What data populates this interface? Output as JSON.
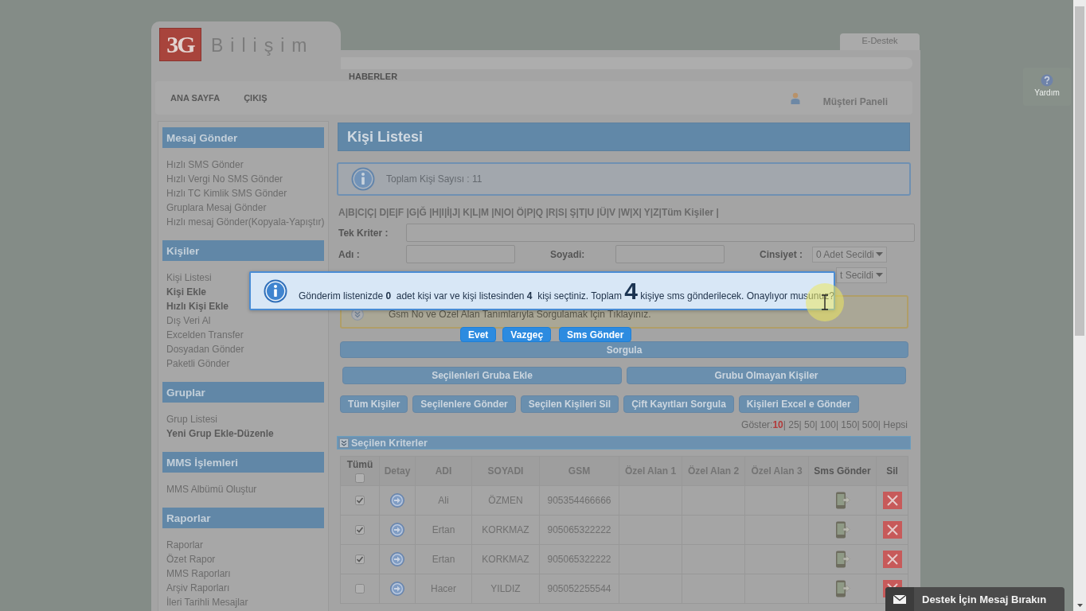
{
  "header": {
    "logo_mark": "3G",
    "logo_text": "Bilişim",
    "top_tab": "E-Destek",
    "news_label": "HABERLER"
  },
  "nav": {
    "links": [
      "ANA SAYFA",
      "ÇIKIŞ"
    ],
    "panel_link": "Müşteri Paneli"
  },
  "help_button": {
    "label": "Yardım"
  },
  "sidebar": [
    {
      "title": "Mesaj Gönder",
      "items": [
        {
          "label": "Hızlı SMS Gönder",
          "emphasized": false
        },
        {
          "label": "Hızlı Vergi No SMS Gönder",
          "emphasized": false
        },
        {
          "label": "Hızlı TC Kimlik SMS Gönder",
          "emphasized": false
        },
        {
          "label": "Gruplara Mesaj Gönder",
          "emphasized": false
        },
        {
          "label": "Hızlı mesaj Gönder(Kopyala-Yapıştır)",
          "emphasized": false
        }
      ]
    },
    {
      "title": "Kişiler",
      "items": [
        {
          "label": "Kişi Listesi",
          "emphasized": false
        },
        {
          "label": "Kişi Ekle",
          "emphasized": true
        },
        {
          "label": "Hızlı Kişi Ekle",
          "emphasized": true
        },
        {
          "label": "Dış Veri Al",
          "emphasized": false
        },
        {
          "label": "Excelden Transfer",
          "emphasized": false
        },
        {
          "label": "Dosyadan Gönder",
          "emphasized": false
        },
        {
          "label": "Paketli Gönder",
          "emphasized": false
        }
      ]
    },
    {
      "title": "Gruplar",
      "items": [
        {
          "label": "Grup Listesi",
          "emphasized": false
        },
        {
          "label": "Yeni Grup Ekle-Düzenle",
          "emphasized": true
        }
      ]
    },
    {
      "title": "MMS İşlemleri",
      "items": [
        {
          "label": "MMS Albümü Oluştur",
          "emphasized": false
        }
      ]
    },
    {
      "title": "Raporlar",
      "items": [
        {
          "label": "Raporlar",
          "emphasized": false
        },
        {
          "label": "Özet Rapor",
          "emphasized": false
        },
        {
          "label": "MMS Raporları",
          "emphasized": false
        },
        {
          "label": "Arşiv Raporları",
          "emphasized": false
        },
        {
          "label": "İleri Tarihli Mesajlar",
          "emphasized": false
        }
      ]
    }
  ],
  "content": {
    "title": "Kişi Listesi",
    "info": "Toplam Kişi Sayısı : 11",
    "alphabet_filter": "A|B|C|Ç| D|E|F |G|Ğ |H|I|İ|J| K|L|M |N|O| Ö|P|Q |R|S| Ş|T|U |Ü|V |W|X| Y|Z|Tüm Kişiler |",
    "search_form": {
      "single_criterion_label": "Tek Kriter :",
      "first_name_label": "Adı :",
      "last_name_label": "Soyadi:",
      "gender_label": "Cinsiyet :",
      "gender_value": "0 Adet Secildi",
      "select_2_value": "t Secildi"
    },
    "criteria_hint": "Gsm No ve Özel Alan Tanımlarıyla Sorgulamak İçin Tıklayınız.",
    "query_button": "Sorgula",
    "group_buttons": [
      "Seçilenleri Gruba Ekle",
      "Grubu Olmayan Kişiler"
    ],
    "action_buttons": [
      "Tüm Kişiler",
      "Seçilenlere Gönder",
      "Seçilen Kişileri Sil",
      "Çift Kayıtları Sorgula",
      "Kişileri Excel e Gönder"
    ],
    "page_size": {
      "label": "Göster:",
      "options": [
        {
          "label": "10",
          "selected": true
        },
        {
          "label": "| 25",
          "selected": false
        },
        {
          "label": "| 50",
          "selected": false
        },
        {
          "label": "| 100",
          "selected": false
        },
        {
          "label": "| 150",
          "selected": false
        },
        {
          "label": "| 500",
          "selected": false
        },
        {
          "label": "| Hepsi",
          "selected": false
        }
      ]
    },
    "criteria_bar": "Seçilen Kriterler",
    "table": {
      "select_all": false,
      "columns": [
        {
          "label": "Tümü",
          "kind": "select",
          "sortable": false
        },
        {
          "label": "Detay",
          "kind": "detail",
          "sortable": true
        },
        {
          "label": "ADI",
          "kind": "first_name",
          "sortable": true
        },
        {
          "label": "SOYADI",
          "kind": "last_name",
          "sortable": true
        },
        {
          "label": "GSM",
          "kind": "gsm",
          "sortable": true
        },
        {
          "label": "Özel Alan 1",
          "kind": "custom",
          "sortable": true
        },
        {
          "label": "Özel Alan 2",
          "kind": "custom",
          "sortable": true
        },
        {
          "label": "Özel Alan 3",
          "kind": "custom",
          "sortable": true
        },
        {
          "label": "Sms Gönder",
          "kind": "sms",
          "sortable": false
        },
        {
          "label": "Sil",
          "kind": "delete",
          "sortable": false
        }
      ],
      "rows": [
        {
          "checked": true,
          "first_name": "Ali",
          "last_name": "ÖZMEN",
          "gsm": "905354466666"
        },
        {
          "checked": true,
          "first_name": "Ertan",
          "last_name": "KORKMAZ",
          "gsm": "905065322222"
        },
        {
          "checked": true,
          "first_name": "Ertan",
          "last_name": "KORKMAZ",
          "gsm": "905065322222"
        },
        {
          "checked": false,
          "first_name": "Hacer",
          "last_name": "YILDIZ",
          "gsm": "905052255544"
        }
      ]
    }
  },
  "dialog": {
    "message": [
      {
        "text": "Gönderim listenizde ",
        "kind": "plain"
      },
      {
        "text": "0",
        "kind": "bold"
      },
      {
        "text": "  adet kişi var ve kişi listesinden ",
        "kind": "plain"
      },
      {
        "text": "4",
        "kind": "bold"
      },
      {
        "text": "  kişi seçtiniz. Toplam ",
        "kind": "plain"
      },
      {
        "text": "4",
        "kind": "large"
      },
      {
        "text": " kişiye sms gönderilecek. Onaylıyor musunuz?",
        "kind": "plain"
      }
    ],
    "buttons": [
      "Evet",
      "Vazgeç",
      "Sms Gönder"
    ]
  },
  "support_chat": "Destek İçin Mesaj Bırakın"
}
